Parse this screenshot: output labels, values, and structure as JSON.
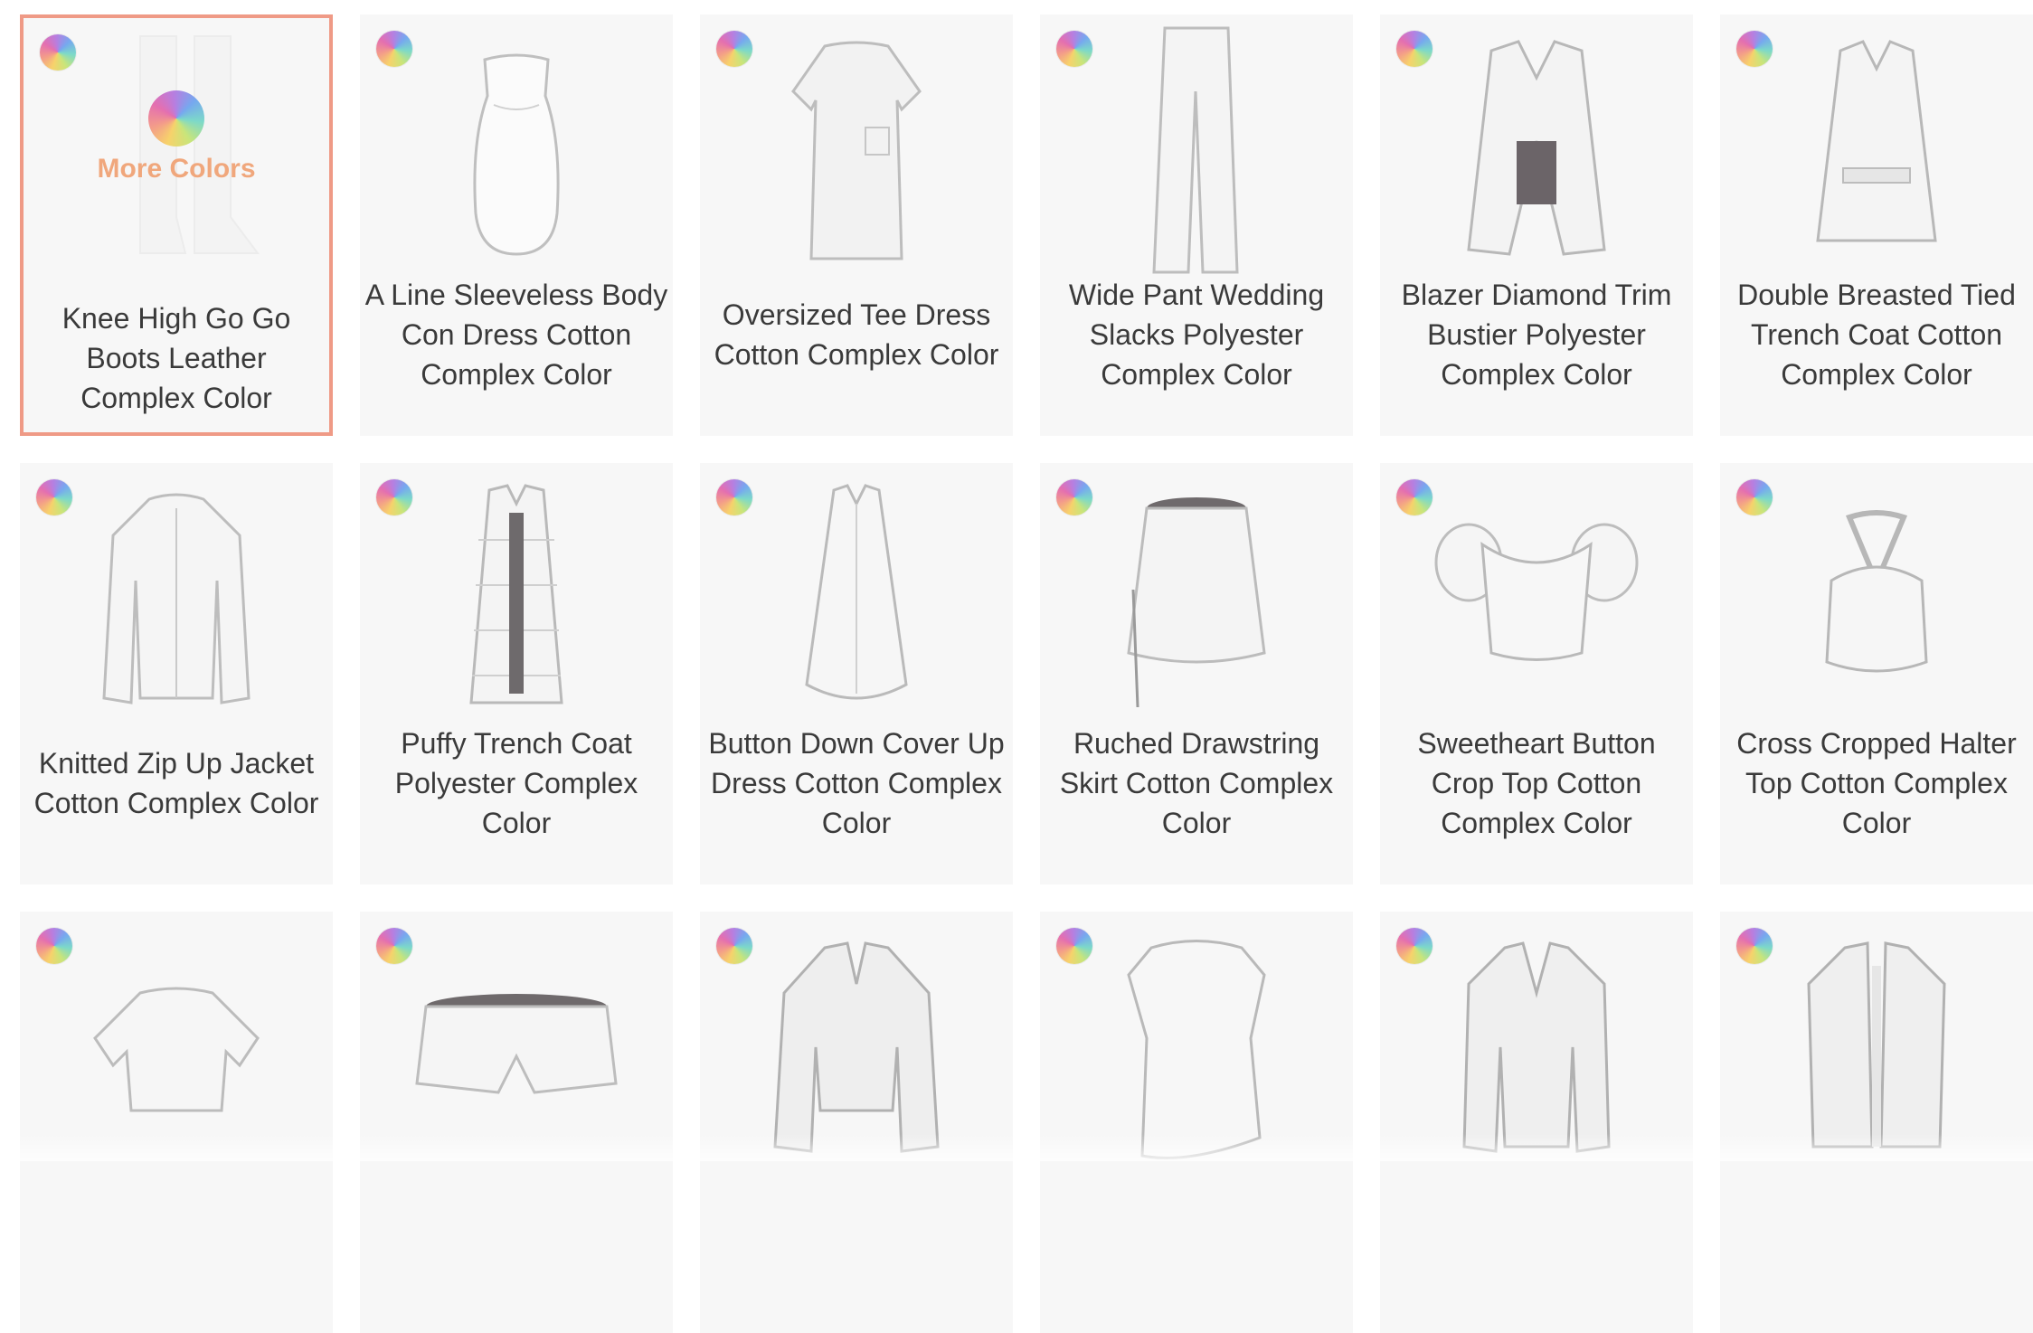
{
  "items": [
    {
      "title": "Knee High Go Go Boots Leather Complex Color",
      "icon": "boots-icon"
    },
    {
      "title": "A Line Sleeveless Body Con Dress Cotton Complex Color",
      "icon": "dress-icon"
    },
    {
      "title": "Oversized Tee Dress Cotton Complex Color",
      "icon": "tee-dress-icon"
    },
    {
      "title": "Wide Pant Wedding Slacks Polyester Complex Color",
      "icon": "pants-icon"
    },
    {
      "title": "Blazer Diamond Trim Bustier Polyester Complex Color",
      "icon": "blazer-icon"
    },
    {
      "title": "Double Breasted Tied Trench Coat Cotton Complex Color",
      "icon": "trench-coat-icon"
    },
    {
      "title": "Knitted Zip Up Jacket Cotton Complex Color",
      "icon": "jacket-icon"
    },
    {
      "title": "Puffy Trench Coat Polyester Complex Color",
      "icon": "puffy-coat-icon"
    },
    {
      "title": "Button Down Cover Up Dress Cotton Complex Color",
      "icon": "shirt-dress-icon"
    },
    {
      "title": "Ruched Drawstring Skirt Cotton Complex Color",
      "icon": "skirt-icon"
    },
    {
      "title": "Sweetheart Button Crop Top Cotton Complex Color",
      "icon": "crop-top-icon"
    },
    {
      "title": "Cross Cropped Halter Top Cotton Complex Color",
      "icon": "halter-top-icon"
    },
    {
      "title": "",
      "icon": "cropped-tee-icon"
    },
    {
      "title": "",
      "icon": "shorts-icon"
    },
    {
      "title": "",
      "icon": "sweater-icon"
    },
    {
      "title": "",
      "icon": "tank-top-icon"
    },
    {
      "title": "",
      "icon": "cardigan-icon"
    },
    {
      "title": "",
      "icon": "open-cardigan-icon"
    }
  ],
  "hover": {
    "more_colors_label": "More Colors"
  },
  "colors": {
    "accent": "#f0a77c",
    "selected_border": "#ef9a86",
    "card_bg": "#f7f7f7",
    "text": "#3a3a3a"
  }
}
